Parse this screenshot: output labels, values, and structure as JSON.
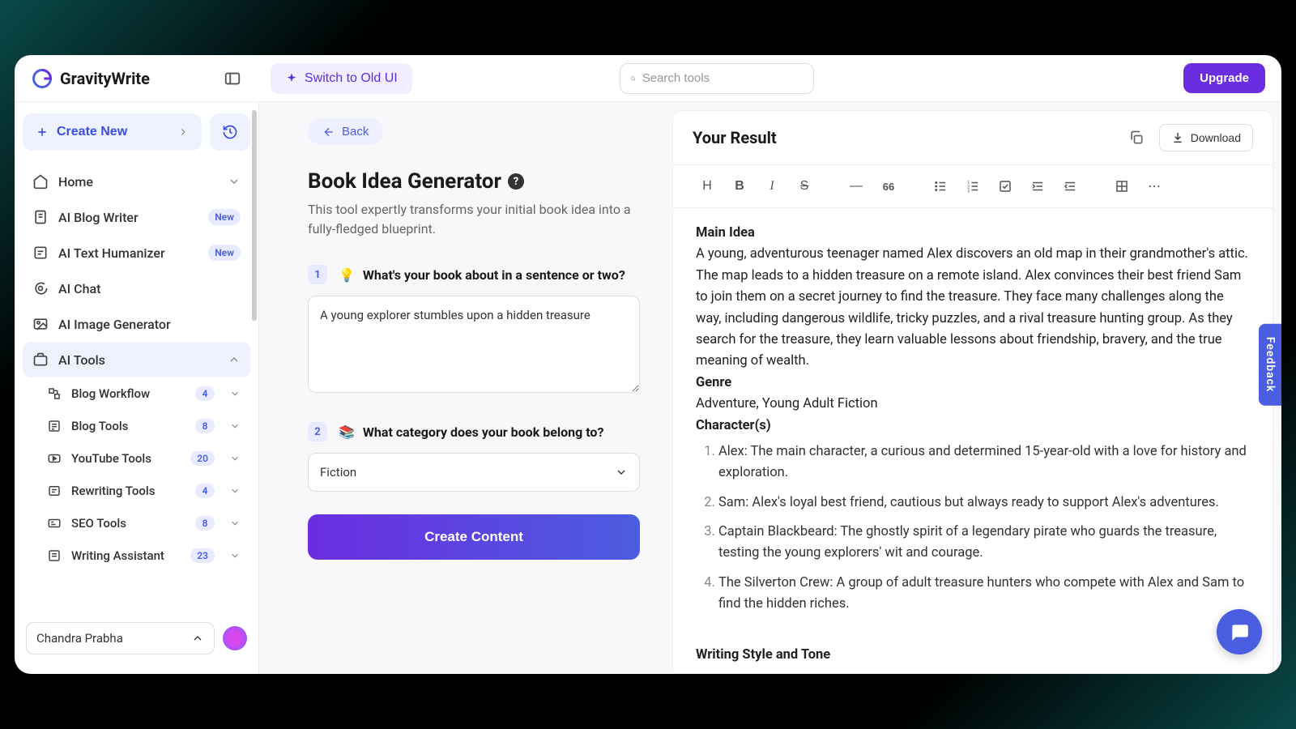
{
  "brand": "GravityWrite",
  "topbar": {
    "switch_label": "Switch to Old UI",
    "search_placeholder": "Search tools",
    "upgrade_label": "Upgrade"
  },
  "sidebar": {
    "create_label": "Create New",
    "items": [
      {
        "label": "Home"
      },
      {
        "label": "AI Blog Writer",
        "badge": "New"
      },
      {
        "label": "AI Text Humanizer",
        "badge": "New"
      },
      {
        "label": "AI Chat"
      },
      {
        "label": "AI Image Generator"
      },
      {
        "label": "AI Tools"
      }
    ],
    "tools": [
      {
        "label": "Blog Workflow",
        "count": "4"
      },
      {
        "label": "Blog Tools",
        "count": "8"
      },
      {
        "label": "YouTube Tools",
        "count": "20"
      },
      {
        "label": "Rewriting Tools",
        "count": "4"
      },
      {
        "label": "SEO Tools",
        "count": "8"
      },
      {
        "label": "Writing Assistant",
        "count": "23"
      }
    ],
    "user_name": "Chandra Prabha"
  },
  "form": {
    "back_label": "Back",
    "title": "Book Idea Generator",
    "subtitle": "This tool expertly transforms your initial book idea into a fully-fledged blueprint.",
    "q1_label": "What's your book about in a sentence or two?",
    "q1_value": "A young explorer stumbles upon a hidden treasure",
    "q2_label": "What category does your book belong to?",
    "q2_value": "Fiction",
    "submit_label": "Create Content"
  },
  "result": {
    "title": "Your Result",
    "download_label": "Download",
    "headings": {
      "main_idea": "Main Idea",
      "genre": "Genre",
      "characters": "Character(s)",
      "style": "Writing Style and Tone"
    },
    "main_idea_text": "A young, adventurous teenager named Alex discovers an old map in their grandmother's attic. The map leads to a hidden treasure on a remote island. Alex convinces their best friend Sam to join them on a secret journey to find the treasure. They face many challenges along the way, including dangerous wildlife, tricky puzzles, and a rival treasure hunting group. As they search for the treasure, they learn valuable lessons about friendship, bravery, and the true meaning of wealth.",
    "genre_text": "Adventure, Young Adult Fiction",
    "characters": [
      "Alex: The main character, a curious and determined 15-year-old with a love for history and exploration.",
      "Sam: Alex's loyal best friend, cautious but always ready to support Alex's adventures.",
      "Captain Blackbeard: The ghostly spirit of a legendary pirate who guards the treasure, testing the young explorers' wit and courage.",
      "The Silverton Crew: A group of adult treasure hunters who compete with Alex and Sam to find the hidden riches."
    ]
  },
  "feedback_label": "Feedback"
}
